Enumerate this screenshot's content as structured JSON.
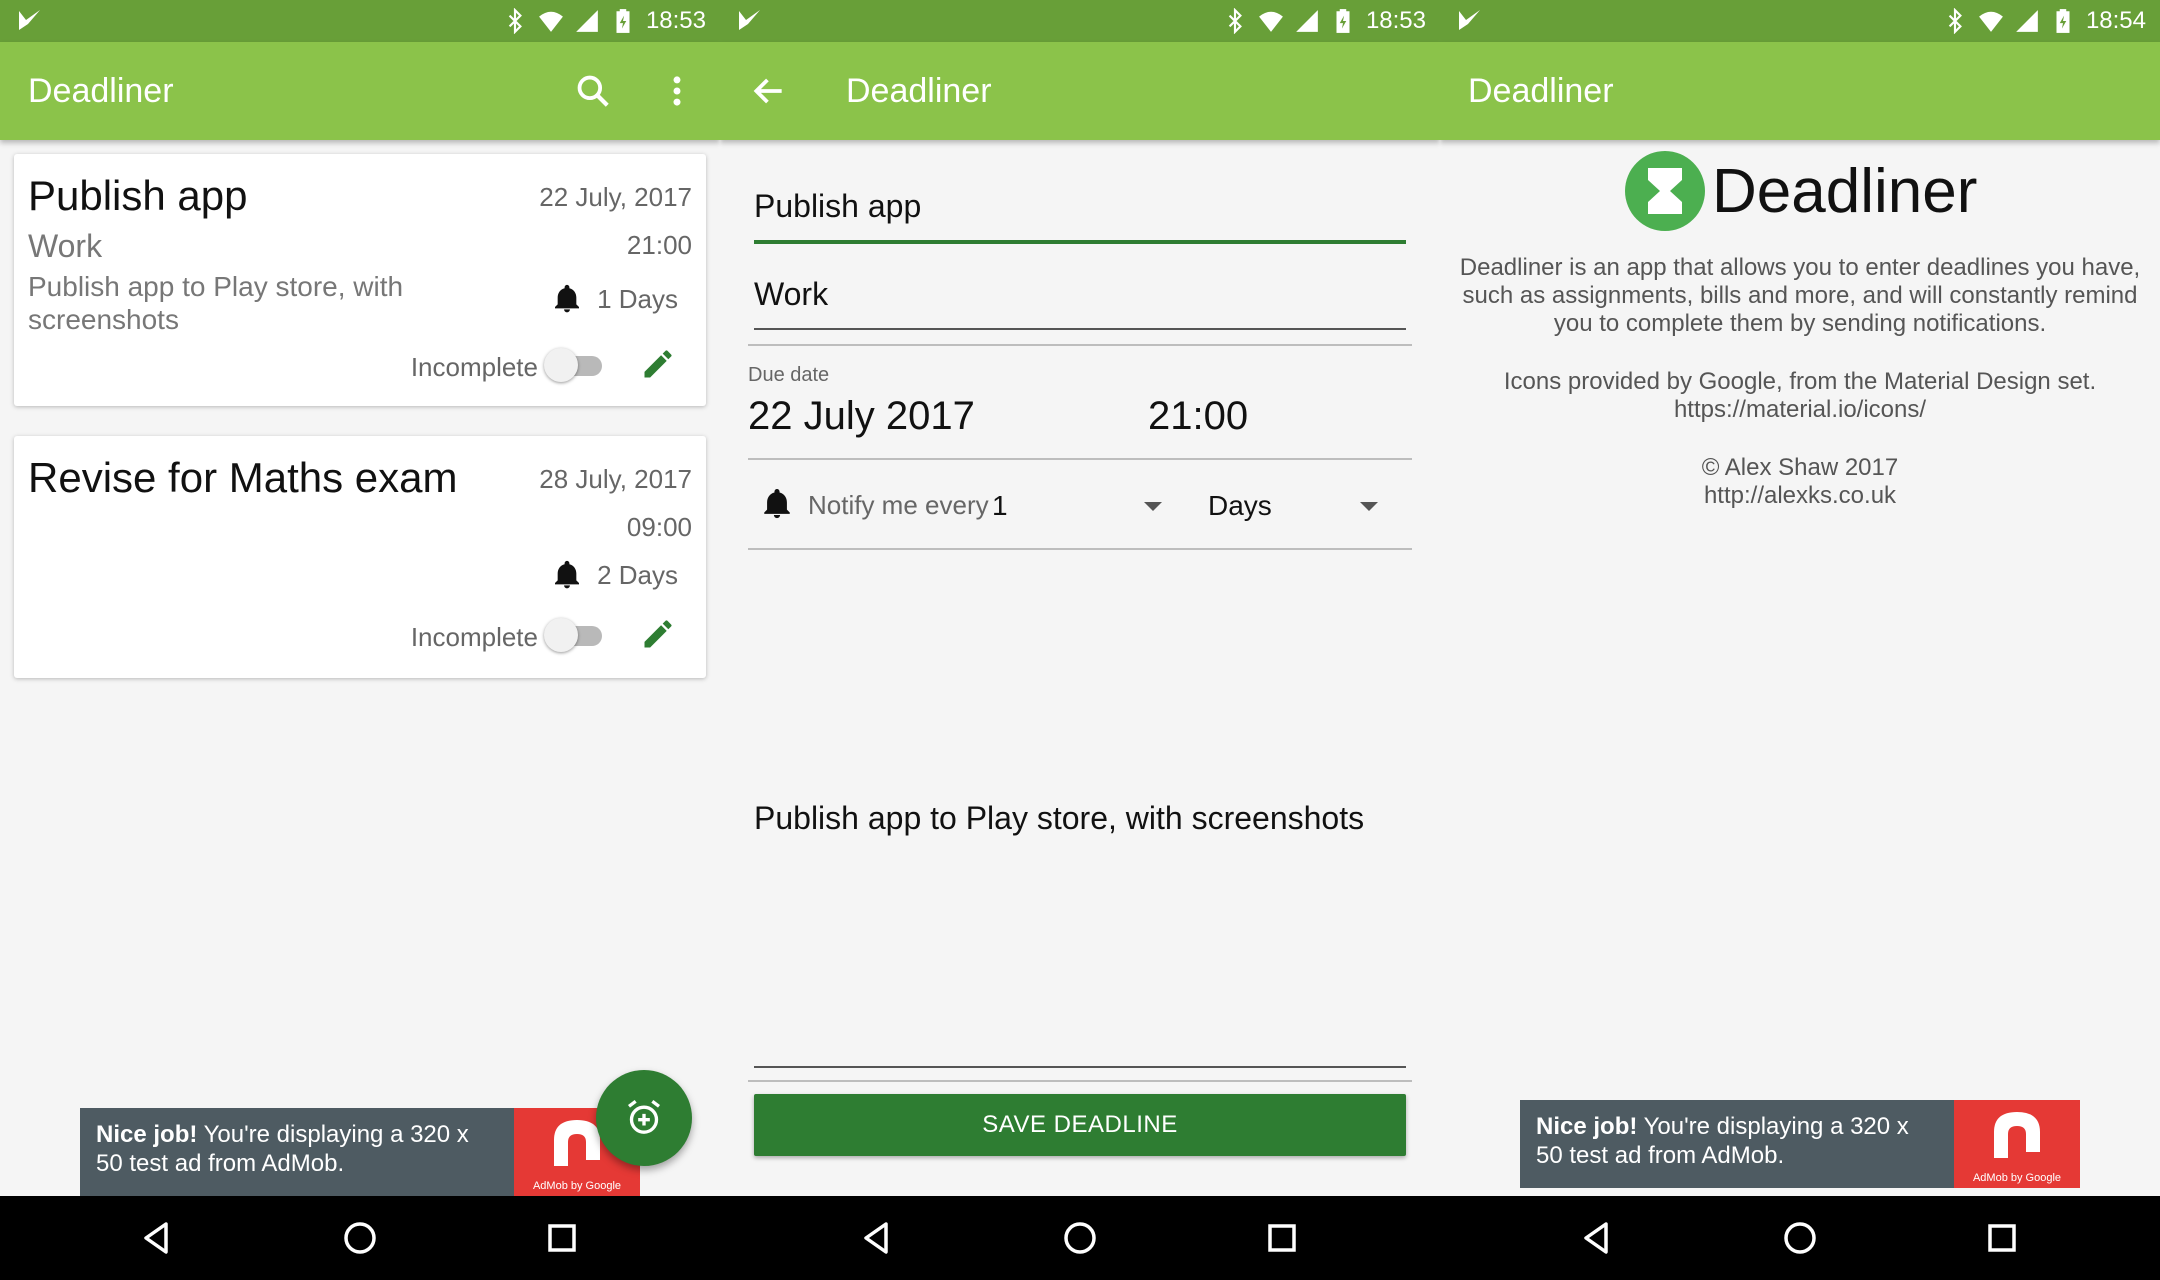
{
  "status_bar": [
    {
      "time": "18:53"
    },
    {
      "time": "18:53"
    },
    {
      "time": "18:54"
    }
  ],
  "app": {
    "name": "Deadliner",
    "primary_color": "#8bc34a",
    "status_color": "#689f38",
    "accent_color": "#2e7d32"
  },
  "list_screen": {
    "title": "Deadliner",
    "deadlines": [
      {
        "title": "Publish app",
        "category": "Work",
        "description": "Publish app to Play store, with screenshots",
        "date": "22 July, 2017",
        "time": "21:00",
        "notify": "1 Days",
        "status": "Incomplete"
      },
      {
        "title": "Revise for Maths exam",
        "category": "",
        "description": "",
        "date": "28 July, 2017",
        "time": "09:00",
        "notify": "2 Days",
        "status": "Incomplete"
      }
    ]
  },
  "edit_screen": {
    "title": "Deadliner",
    "name_value": "Publish app",
    "category_value": "Work",
    "due_date_label": "Due date",
    "due_date": "22 July 2017",
    "due_time": "21:00",
    "notify_label": "Notify me every",
    "notify_value": "1",
    "notify_unit": "Days",
    "description_value": "Publish app to Play store, with screenshots",
    "save_label": "SAVE DEADLINE"
  },
  "about_screen": {
    "title": "Deadliner",
    "logo_text": "Deadliner",
    "description": "Deadliner is an app that allows you to enter deadlines you have, such as assignments, bills and more, and will constantly remind you to complete them by sending notifications.",
    "icons_credit": "Icons provided by Google, from the Material Design set.",
    "icons_url": "https://material.io/icons/",
    "copyright": "© Alex Shaw 2017",
    "website": "http://alexks.co.uk"
  },
  "ad": {
    "bold": "Nice job!",
    "text": " You're displaying a 320 x 50 test ad from AdMob.",
    "logo_caption": "AdMob by Google",
    "logo_color": "#e53935"
  }
}
